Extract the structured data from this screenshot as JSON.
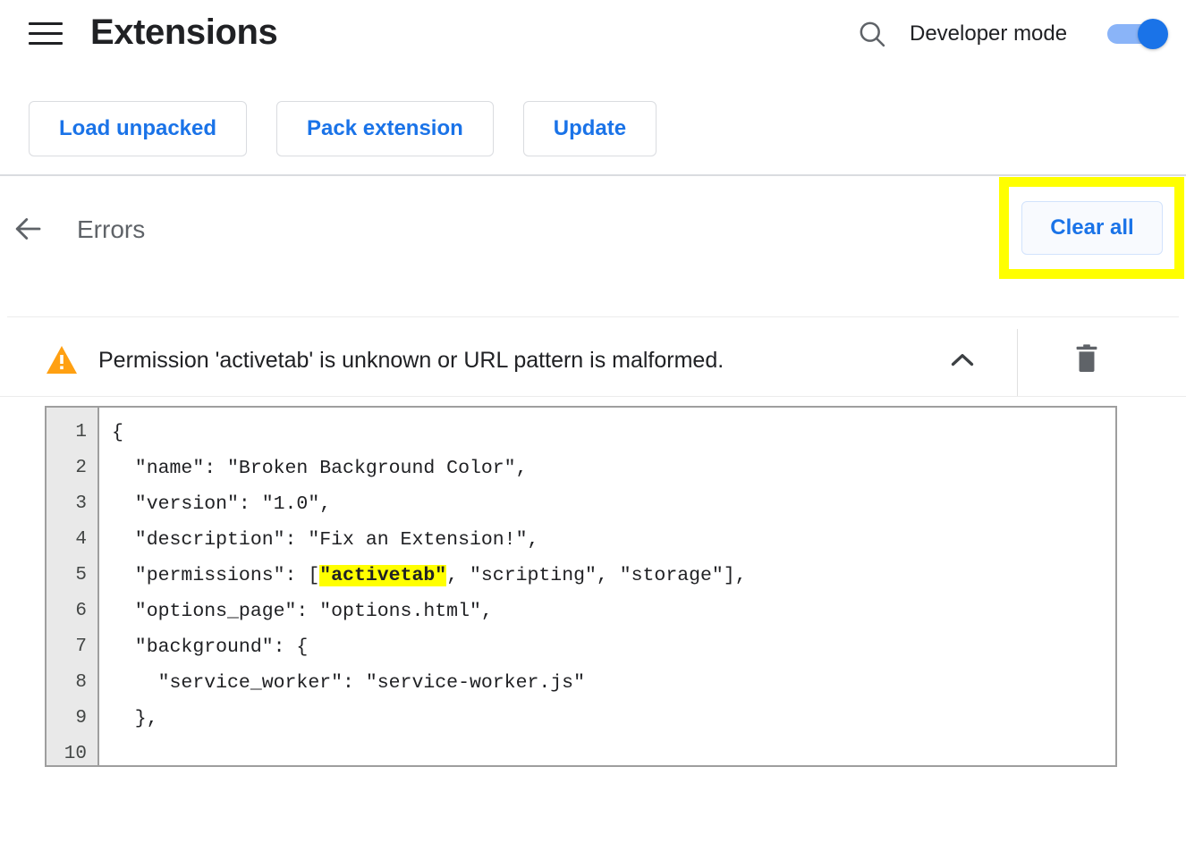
{
  "header": {
    "menu_icon": "hamburger-menu-icon",
    "title": "Extensions",
    "search_icon": "search-icon",
    "developer_mode_label": "Developer mode",
    "developer_mode_on": true,
    "toggle_color": "#1a73e8"
  },
  "toolbar": {
    "buttons": [
      {
        "label": "Load unpacked",
        "name": "load-unpacked-button"
      },
      {
        "label": "Pack extension",
        "name": "pack-extension-button"
      },
      {
        "label": "Update",
        "name": "update-button"
      }
    ],
    "button_text_color": "#1a73e8"
  },
  "errors_page": {
    "back_icon": "back-arrow-icon",
    "title": "Errors",
    "clear_all_label": "Clear all",
    "highlight_color": "#ffff00"
  },
  "error_item": {
    "severity_icon": "warning-triangle-icon",
    "severity_color": "#ffa012",
    "message": "Permission 'activetab' is unknown or URL pattern is malformed.",
    "collapse_icon": "chevron-up-icon",
    "delete_icon": "trash-icon",
    "expanded": true
  },
  "code_viewer": {
    "line_numbers": [
      "1",
      "2",
      "3",
      "4",
      "5",
      "6",
      "7",
      "8",
      "9",
      "10"
    ],
    "lines": [
      {
        "text": "{"
      },
      {
        "text": "  \"name\": \"Broken Background Color\","
      },
      {
        "text": "  \"version\": \"1.0\","
      },
      {
        "text": "  \"description\": \"Fix an Extension!\","
      },
      {
        "pre": "  \"permissions\": [",
        "highlight": "\"activetab\"",
        "post": ", \"scripting\", \"storage\"],"
      },
      {
        "text": "  \"options_page\": \"options.html\","
      },
      {
        "text": "  \"background\": {"
      },
      {
        "text": "    \"service_worker\": \"service-worker.js\""
      },
      {
        "text": "  },"
      },
      {
        "text": ""
      }
    ],
    "highlight_color": "#ffff00"
  }
}
